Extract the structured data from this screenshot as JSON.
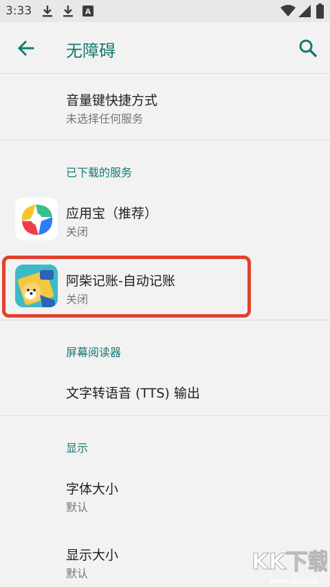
{
  "status_bar": {
    "time": "3:33",
    "left_icons": [
      "download-icon",
      "download-icon",
      "a-notification-icon"
    ],
    "right_icons": [
      "wifi-icon",
      "signal-icon",
      "battery-icon"
    ]
  },
  "app_bar": {
    "title": "无障碍",
    "back_icon": "arrow-back-icon",
    "search_icon": "search-icon"
  },
  "volume_shortcut": {
    "title": "音量键快捷方式",
    "subtitle": "未选择任何服务"
  },
  "downloaded_services": {
    "header": "已下载的服务",
    "items": [
      {
        "title": "应用宝（推荐）",
        "subtitle": "关闭",
        "icon": "yingyongbao-app-icon"
      },
      {
        "title": "阿柴记账-自动记账",
        "subtitle": "关闭",
        "icon": "achai-app-icon"
      }
    ]
  },
  "screen_reader": {
    "header": "屏幕阅读器",
    "items": [
      {
        "title": "文字转语音 (TTS) 输出"
      }
    ]
  },
  "display": {
    "header": "显示",
    "items": [
      {
        "title": "字体大小",
        "subtitle": "默认"
      },
      {
        "title": "显示大小",
        "subtitle": "默认"
      }
    ]
  },
  "watermark": {
    "logo_text": "KK下载",
    "url": "www.kkx.net"
  },
  "colors": {
    "accent": "#127a70",
    "highlight_border": "#e1412c",
    "background": "#f2f2f2"
  }
}
